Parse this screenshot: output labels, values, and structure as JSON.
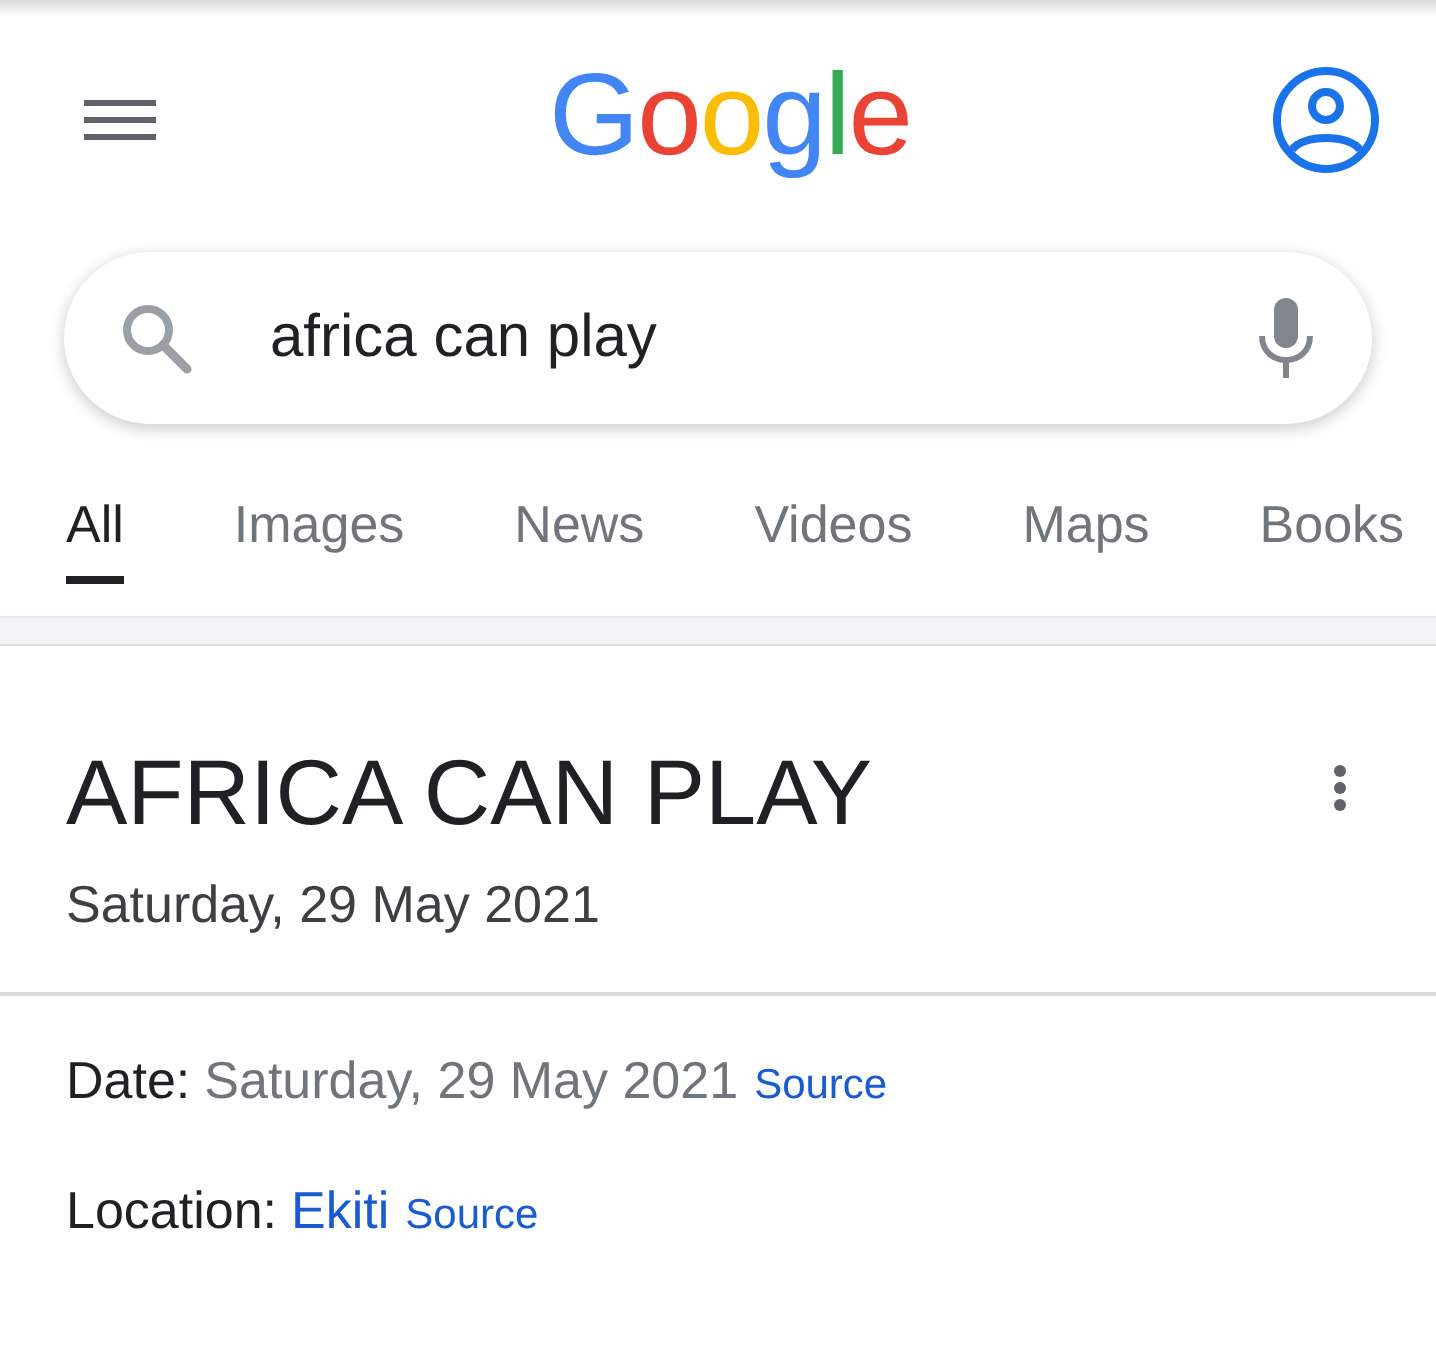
{
  "header": {
    "logo": "Google"
  },
  "search": {
    "value": "africa can play"
  },
  "tabs": [
    {
      "label": "All",
      "selected": true
    },
    {
      "label": "Images",
      "selected": false
    },
    {
      "label": "News",
      "selected": false
    },
    {
      "label": "Videos",
      "selected": false
    },
    {
      "label": "Maps",
      "selected": false
    },
    {
      "label": "Books",
      "selected": false
    }
  ],
  "result": {
    "title": "AFRICA CAN PLAY",
    "subtitle": "Saturday, 29 May 2021",
    "facts": [
      {
        "label": "Date:",
        "value": "Saturday, 29 May 2021",
        "kind": "text",
        "source": "Source"
      },
      {
        "label": "Location:",
        "value": "Ekiti",
        "kind": "link",
        "source": "Source"
      }
    ]
  }
}
